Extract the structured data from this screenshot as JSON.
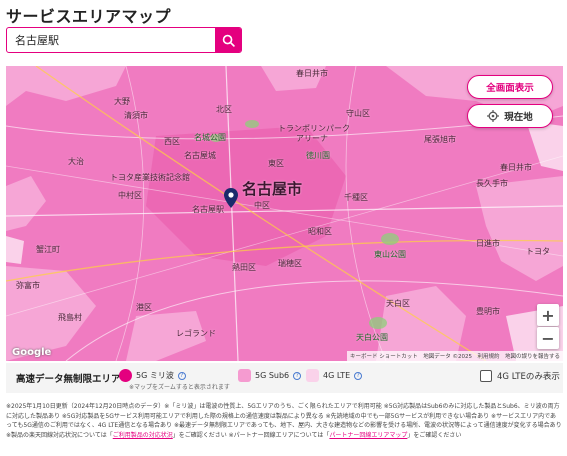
{
  "page": {
    "title": "サービスエリアマップ"
  },
  "search": {
    "value": "名古屋駅",
    "button_icon": "search-icon"
  },
  "map": {
    "buttons": {
      "fullscreen": "全画面表示",
      "current_location": "現在地"
    },
    "zoom": {
      "in": "+",
      "out": "−"
    },
    "google": "Google",
    "attribution": "キーボード ショートカット　地図データ ©2025　利用規約　地図の誤りを報告する",
    "labels": {
      "nagoya": "名古屋市",
      "nagoya_station": "名古屋駅",
      "kasugai": "春日井市",
      "kasugai_city": "春日井市",
      "ono": "大野",
      "ohashi": "大治",
      "kiyosu": "清須市",
      "nishi": "西区",
      "kita": "北区",
      "higashi": "東区",
      "chikusa": "千種区",
      "nakamura": "中村区",
      "naka": "中区",
      "showa": "昭和区",
      "mizuho": "瑞穂区",
      "minato": "港区",
      "atsuta": "熱田区",
      "tempaku": "天白区",
      "nagakute": "長久手市",
      "owariasahi": "尾張旭市",
      "nisshin": "日進市",
      "toyoake": "豊明市",
      "kanie": "蟹江町",
      "tobishima": "飛島村",
      "yatomi": "弥富市",
      "toyota": "トヨタ",
      "toyota_museum": "トヨタ産業技術記念館",
      "higashiyama": "東山公園",
      "tenpaku_park": "天白公園",
      "legoland": "レゴランド",
      "nagoya_castle": "名古屋城",
      "tokugawa": "徳川園",
      "meijo": "名城公園",
      "moriyama": "守山区",
      "trans": "トランポリンパーク",
      "gyoza": "アリーナ"
    }
  },
  "legend": {
    "title": "高速データ無制限エリア",
    "items": [
      {
        "label": "5G ミリ波",
        "color": "#e4007f"
      },
      {
        "label": "5G Sub6",
        "color": "#f59bd0"
      },
      {
        "label": "4G LTE",
        "color": "#fad2ea"
      }
    ],
    "note": "※マップをズームすると表示されます",
    "lte_only": "4G LTEのみ表示"
  },
  "notes": {
    "text1": "※2025年1月10日更新（2024年12月20日時点のデータ）※「ミリ波」は電波の性質上、5Gエリアのうち、ごく限られたエリアで利用可能 ※5G対応製品はSub6のみに対応した製品とSub6、ミリ波の両方に対応した製品あり ※5G対応製品を5Gサービス利用可能エリアで利用した際の規格上の通信速度は製品により異なる ※先読地域の中でも一部5Gサービスが利用できない場合あり ※サービスエリア内であっても5G通信のご利用ではなく、4G LTE通信となる場合あり ※最速データ無制限エリアであっても、地下、屋内、大きな建造物などの影響を受ける場所、電波の状況等によって通信速度が変化する場合あり ※製品の楽天回線対応状況については「",
    "link1": "ご利用製品の対応状況",
    "text2": "」をご確認ください ※パートナー回線エリアについては「",
    "link2": "パートナー回線エリアマップ",
    "text3": "」をご確認ください"
  }
}
